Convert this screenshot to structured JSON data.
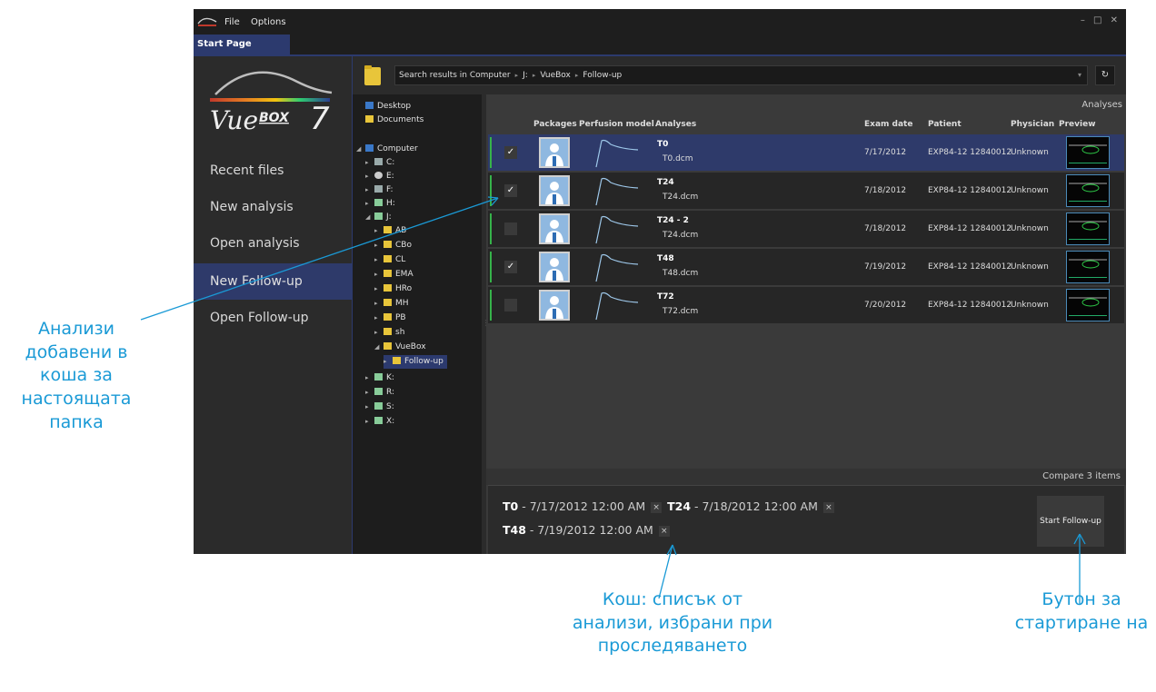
{
  "menu": {
    "file": "File",
    "options": "Options"
  },
  "window_controls": "– □ ✕",
  "tab": {
    "label": "Start Page"
  },
  "logo": {
    "brand": "Vue",
    "mark": "BOX",
    "version": "7"
  },
  "nav": [
    {
      "label": "Recent files",
      "active": false
    },
    {
      "label": "New analysis",
      "active": false
    },
    {
      "label": "Open analysis",
      "active": false
    },
    {
      "label": "New Follow-up",
      "active": true
    },
    {
      "label": "Open Follow-up",
      "active": false
    }
  ],
  "path": {
    "prefix": "Search results in Computer",
    "crumbs": [
      "J:",
      "VueBox",
      "Follow-up"
    ],
    "refresh": "↻"
  },
  "tree": [
    {
      "label": "Desktop",
      "icon": "desktop-icon"
    },
    {
      "label": "Documents",
      "icon": "folder-icon"
    },
    {
      "label": "Computer",
      "icon": "computer-icon"
    },
    {
      "label": "C:",
      "icon": "drive-icon"
    },
    {
      "label": "E:",
      "icon": "disc-icon"
    },
    {
      "label": "F:",
      "icon": "drive-icon"
    },
    {
      "label": "H:",
      "icon": "network-drive-icon"
    },
    {
      "label": "J:",
      "icon": "network-drive-icon"
    },
    {
      "label": "AB",
      "icon": "folder-icon"
    },
    {
      "label": "CBo",
      "icon": "folder-icon"
    },
    {
      "label": "CL",
      "icon": "folder-icon"
    },
    {
      "label": "EMA",
      "icon": "folder-icon"
    },
    {
      "label": "HRo",
      "icon": "folder-icon"
    },
    {
      "label": "MH",
      "icon": "folder-icon"
    },
    {
      "label": "PB",
      "icon": "folder-icon"
    },
    {
      "label": "sh",
      "icon": "folder-icon"
    },
    {
      "label": "VueBox",
      "icon": "folder-icon"
    },
    {
      "label": "Follow-up",
      "icon": "folder-icon",
      "selected": true
    },
    {
      "label": "K:",
      "icon": "network-drive-icon"
    },
    {
      "label": "R:",
      "icon": "network-drive-icon"
    },
    {
      "label": "S:",
      "icon": "network-drive-icon"
    },
    {
      "label": "X:",
      "icon": "network-drive-icon"
    }
  ],
  "analyses": {
    "header": "Analyses",
    "columns": {
      "packages": "Packages",
      "perfusion": "Perfusion model",
      "analyses": "Analyses",
      "exam_date": "Exam date",
      "patient": "Patient",
      "physician": "Physician",
      "preview": "Preview"
    },
    "rows": [
      {
        "name": "T0",
        "file": "T0.dcm",
        "date": "7/17/2012",
        "patient": "EXP84-12 12840012",
        "physician": "Unknown",
        "checked": true,
        "selected": true
      },
      {
        "name": "T24",
        "file": "T24.dcm",
        "date": "7/18/2012",
        "patient": "EXP84-12 12840012",
        "physician": "Unknown",
        "checked": true,
        "selected": false
      },
      {
        "name": "T24 - 2",
        "file": "T24.dcm",
        "date": "7/18/2012",
        "patient": "EXP84-12 12840012",
        "physician": "Unknown",
        "checked": false,
        "selected": false
      },
      {
        "name": "T48",
        "file": "T48.dcm",
        "date": "7/19/2012",
        "patient": "EXP84-12 12840012",
        "physician": "Unknown",
        "checked": true,
        "selected": false
      },
      {
        "name": "T72",
        "file": "T72.dcm",
        "date": "7/20/2012",
        "patient": "EXP84-12 12840012",
        "physician": "Unknown",
        "checked": false,
        "selected": false
      }
    ],
    "check_mark": "✓"
  },
  "compare": {
    "header": "Compare 3 items",
    "items": [
      {
        "name": "T0",
        "date": "- 7/17/2012 12:00 AM"
      },
      {
        "name": "T24",
        "date": "- 7/18/2012 12:00 AM"
      },
      {
        "name": "T48",
        "date": "- 7/19/2012 12:00 AM"
      }
    ],
    "remove": "×",
    "start_button": "Start Follow-up"
  },
  "callouts": {
    "left": [
      "Анализи",
      "добавени в",
      "коша за",
      "настоящата",
      "папка"
    ],
    "bottom": [
      "Кош: списък от",
      "анализи, избрани при",
      "проследяването"
    ],
    "right": [
      "Бутон за",
      "стартиране на"
    ]
  },
  "colors": {
    "accent": "#2e3a6a",
    "callout": "#1a9ad6",
    "check_green": "#36b34a"
  }
}
